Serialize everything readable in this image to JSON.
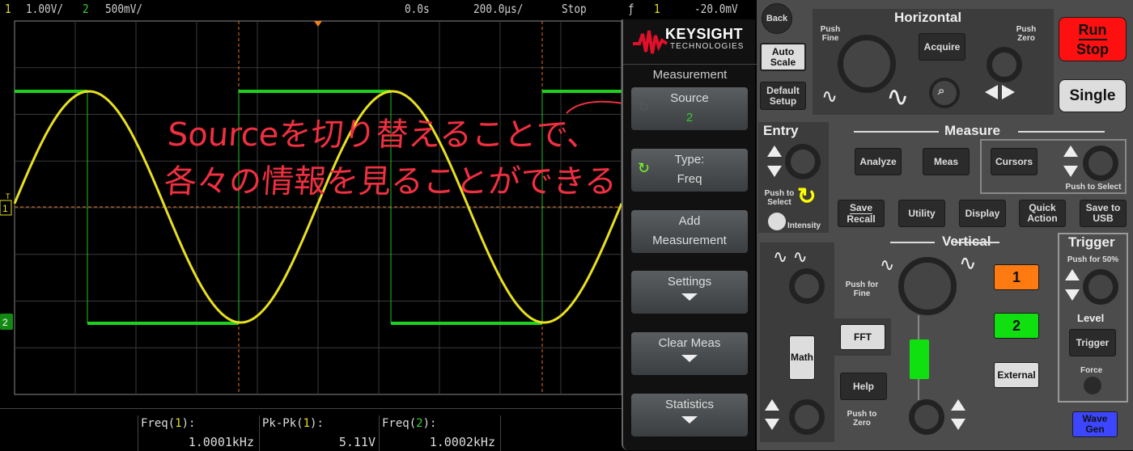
{
  "status_bar": {
    "ch1_num": "1",
    "ch1_scale": "1.00V/",
    "ch2_num": "2",
    "ch2_scale": "500mV/",
    "time_offset": "0.0s",
    "time_scale": "200.0µs/",
    "run_state": "Stop",
    "trigger_slope": "rising-edge-icon",
    "trigger_source": "1",
    "trigger_level": "-20.0mV"
  },
  "screen": {
    "ch1_marker": "1",
    "ch2_marker": "2",
    "trigger_marker": "T",
    "annotation_line1": "Sourceを切り替えることで、",
    "annotation_line2": "各々の情報を見ることができる"
  },
  "measurements": [
    {
      "label_pre": "Freq(",
      "src": "1",
      "label_post": "):",
      "value": "1.0001kHz",
      "color": "#e8e020"
    },
    {
      "label_pre": "Pk-Pk(",
      "src": "1",
      "label_post": "):",
      "value": "5.11V",
      "color": "#e8e020"
    },
    {
      "label_pre": "Freq(",
      "src": "2",
      "label_post": "):",
      "value": "1.0002kHz",
      "color": "#30d030"
    }
  ],
  "menu": {
    "brand": "KEYSIGHT",
    "brand_sub": "TECHNOLOGIES",
    "title": "Measurement",
    "softkeys": [
      {
        "line1": "Source",
        "line2": "2"
      },
      {
        "line1": "Type:",
        "line2": "Freq"
      },
      {
        "line1": "Add",
        "line2": "Measurement"
      },
      {
        "line1": "Settings"
      },
      {
        "line1": "Clear Meas"
      },
      {
        "line1": "Statistics"
      }
    ]
  },
  "panel": {
    "back": "Back",
    "auto_scale": "Auto Scale",
    "default_setup": "Default Setup",
    "horizontal": "Horizontal",
    "push_fine": "Push Fine",
    "acquire": "Acquire",
    "push_zero": "Push Zero",
    "run": "Run",
    "stop": "Stop",
    "single": "Single",
    "entry": "Entry",
    "push_to_select": "Push to Select",
    "intensity": "Intensity",
    "measure": "Measure",
    "analyze": "Analyze",
    "meas": "Meas",
    "cursors": "Cursors",
    "cursors_push": "Push to Select",
    "save": "Save",
    "recall": "Recall",
    "utility": "Utility",
    "display": "Display",
    "quick_action": "Quick Action",
    "save_usb": "Save to USB",
    "vertical": "Vertical",
    "push_for_fine": "Push for Fine",
    "push_to_zero": "Push to Zero",
    "fft": "FFT",
    "math": "Math",
    "help": "Help",
    "ch1": "1",
    "ch2": "2",
    "external": "External",
    "trigger": "Trigger",
    "push_50": "Push for 50%",
    "level": "Level",
    "trigger_btn": "Trigger",
    "force": "Force",
    "wave_gen": "Wave Gen",
    "colors": {
      "run_stop": "#ff1010",
      "ch1": "#ff7a10",
      "ch2": "#10e010",
      "wavegen": "#3c46ff"
    }
  }
}
